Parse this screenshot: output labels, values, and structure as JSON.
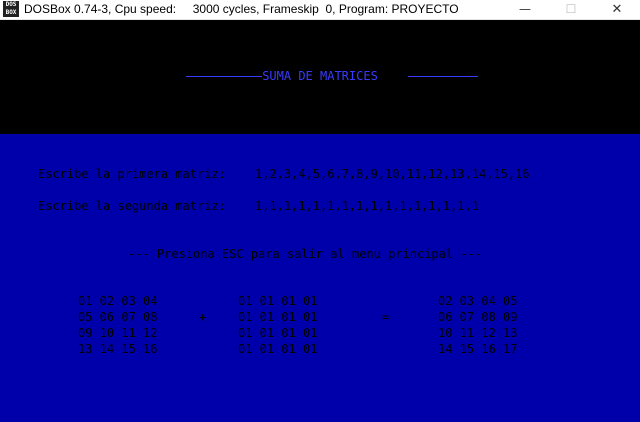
{
  "window": {
    "title": "DOSBox 0.74-3, Cpu speed:     3000 cycles, Frameskip  0, Program: PROYECTO",
    "icon_text": "DOS BOX",
    "buttons": {
      "minimize": "—",
      "maximize": "☐",
      "close": "✕"
    }
  },
  "screen": {
    "title": "SUMA DE MATRICES",
    "prompt1_label": "Escribe la primera matriz:",
    "prompt1_value": "1,2,3,4,5,6,7,8,9,10,11,12,13,14,15,16",
    "prompt2_label": "Escribe la segunda matriz:",
    "prompt2_value": "1,1,1,1,1,1,1,1,1,1,1,1,1,1,1,1",
    "esc_hint": "--- Presiona ESC para salir al menu principal ---",
    "plus": "+",
    "equals": "=",
    "matrix_a": [
      "01 02 03 04",
      "05 06 07 08",
      "09 10 11 12",
      "13 14 15 16"
    ],
    "matrix_b": [
      "01 01 01 01",
      "01 01 01 01",
      "01 01 01 01",
      "01 01 01 01"
    ],
    "matrix_c": [
      "02 03 04 05",
      "06 07 08 09",
      "10 11 12 13",
      "14 15 16 17"
    ]
  }
}
